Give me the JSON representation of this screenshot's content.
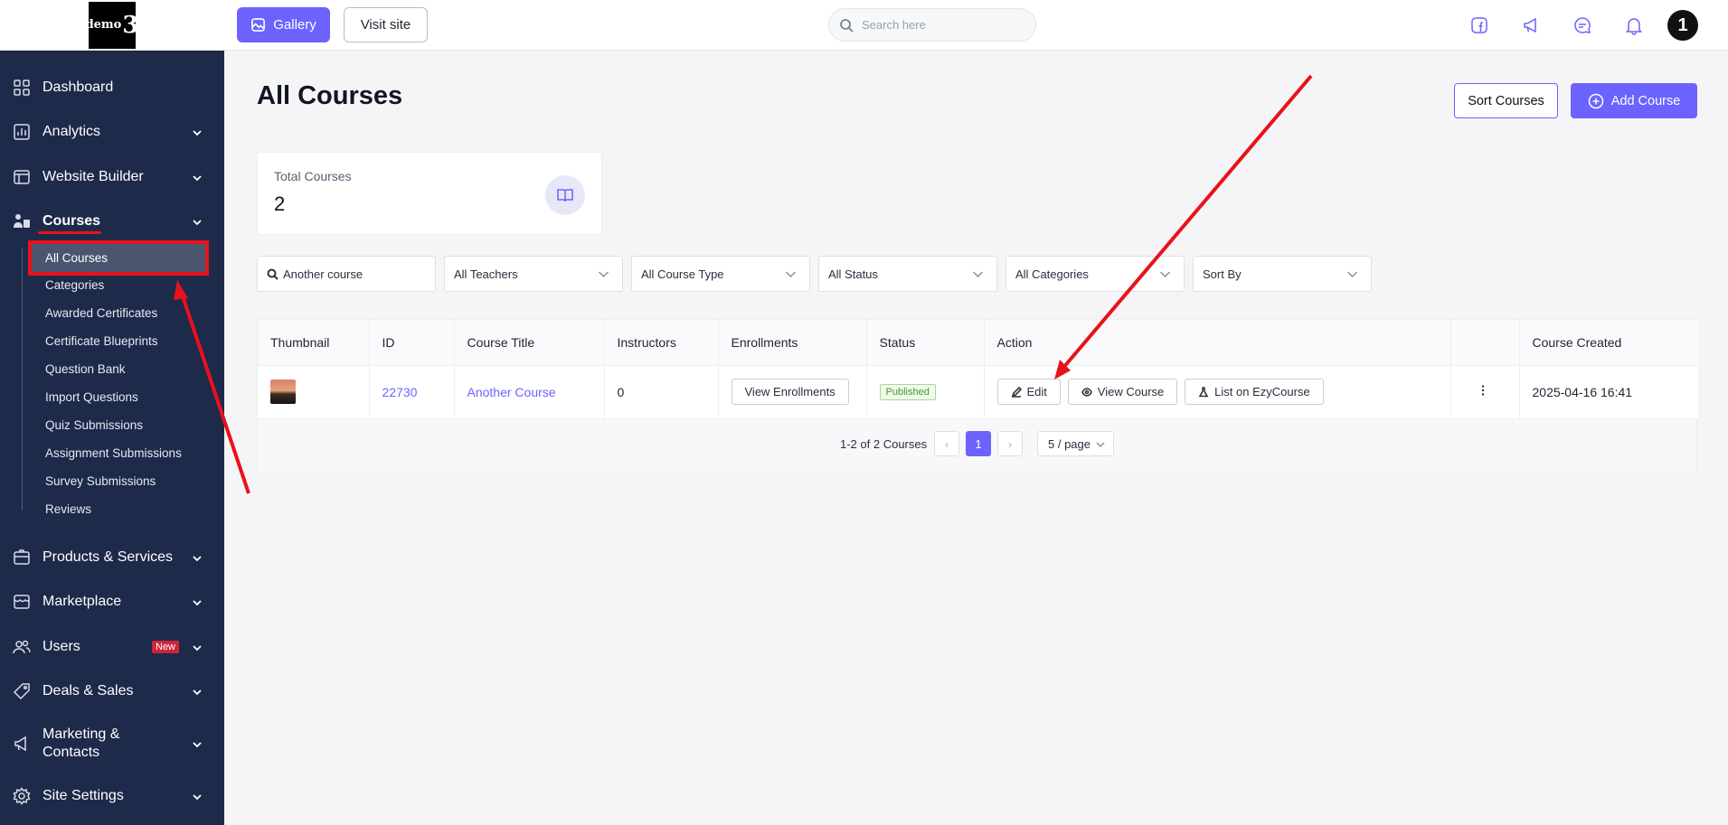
{
  "logo": {
    "small": "demo",
    "big": "3"
  },
  "topbar": {
    "gallery_label": "Gallery",
    "visit_label": "Visit site",
    "search_placeholder": "Search here",
    "avatar_text": "1"
  },
  "sidebar": {
    "items": [
      {
        "label": "Dashboard",
        "icon": "dashboard-icon"
      },
      {
        "label": "Analytics",
        "icon": "analytics-icon"
      },
      {
        "label": "Website Builder",
        "icon": "website-builder-icon"
      },
      {
        "label": "Courses",
        "icon": "courses-icon"
      },
      {
        "label": "Products & Services",
        "icon": "products-icon"
      },
      {
        "label": "Marketplace",
        "icon": "marketplace-icon"
      },
      {
        "label": "Users",
        "icon": "users-icon",
        "badge": "New"
      },
      {
        "label": "Deals & Sales",
        "icon": "deals-icon"
      },
      {
        "label": "Marketing &",
        "label2": "Contacts",
        "icon": "megaphone-icon"
      },
      {
        "label": "Site Settings",
        "icon": "settings-icon"
      }
    ],
    "course_subitems": [
      "All Courses",
      "Categories",
      "Awarded Certificates",
      "Certificate Blueprints",
      "Question Bank",
      "Import Questions",
      "Quiz Submissions",
      "Assignment Submissions",
      "Survey Submissions",
      "Reviews"
    ]
  },
  "main": {
    "title": "All Courses",
    "sort_label": "Sort Courses",
    "add_label": "Add Course",
    "stat": {
      "label": "Total Courses",
      "value": "2"
    },
    "filters": {
      "search_value": "Another course",
      "teachers": "All Teachers",
      "course_type": "All Course Type",
      "status": "All Status",
      "categories": "All Categories",
      "sort_by": "Sort By"
    },
    "table": {
      "headers": [
        "Thumbnail",
        "ID",
        "Course Title",
        "Instructors",
        "Enrollments",
        "Status",
        "Action",
        "",
        "Course Created"
      ],
      "rows": [
        {
          "id": "22730",
          "title": "Another Course",
          "instructors": "0",
          "enrollments_btn": "View Enrollments",
          "status": "Published",
          "edit": "Edit",
          "view": "View Course",
          "list": "List on EzyCourse",
          "created": "2025-04-16 16:41"
        }
      ]
    },
    "pagination": {
      "info": "1-2 of 2 Courses",
      "current_page": "1",
      "page_size": "5 / page"
    }
  },
  "colors": {
    "accent": "#6c63ff",
    "sidebar": "#1e2a4a",
    "annotation": "#e8121b"
  }
}
